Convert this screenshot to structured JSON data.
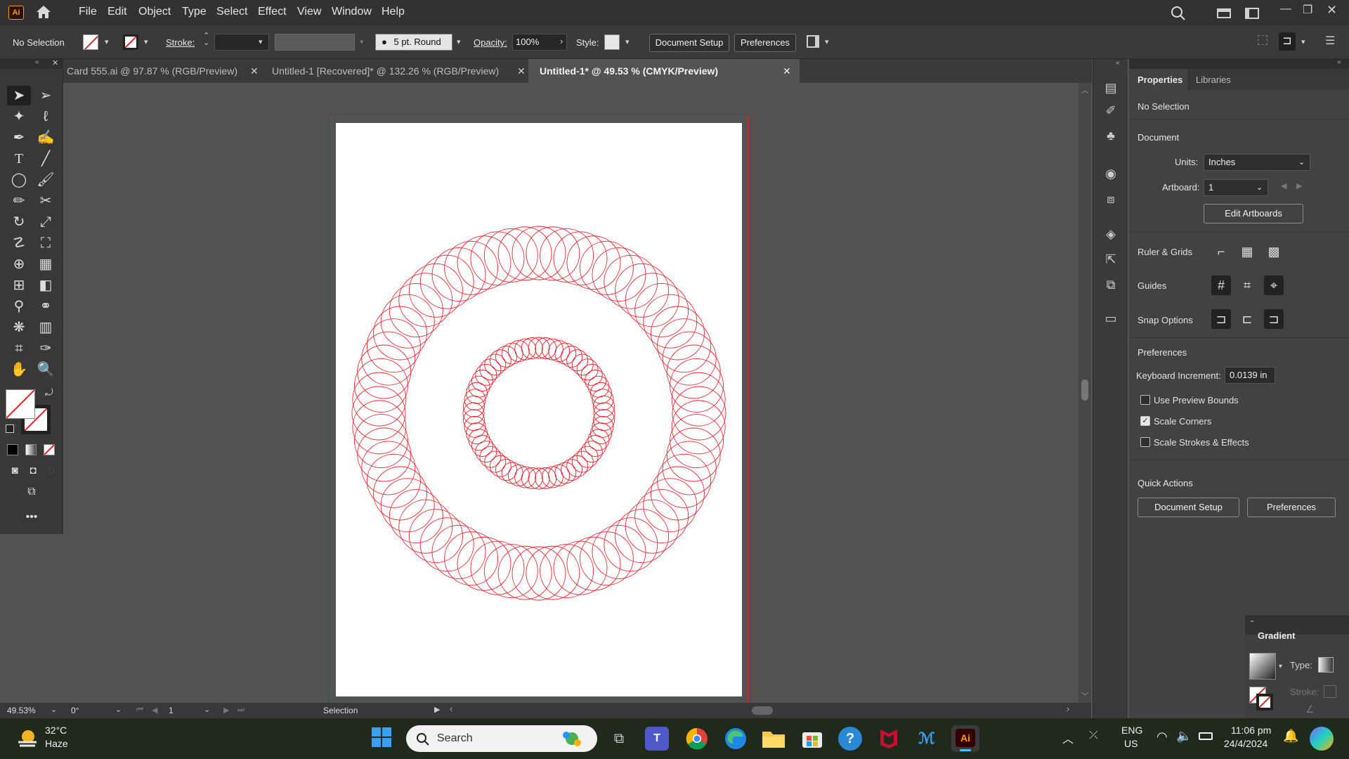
{
  "app": {
    "logo": "Ai",
    "home_icon": "home-icon"
  },
  "menu": [
    "File",
    "Edit",
    "Object",
    "Type",
    "Select",
    "Effect",
    "View",
    "Window",
    "Help"
  ],
  "control": {
    "selection": "No Selection",
    "stroke_label": "Stroke:",
    "brush": "5 pt. Round",
    "opacity_label": "Opacity:",
    "opacity_value": "100%",
    "style_label": "Style:",
    "doc_setup": "Document Setup",
    "preferences": "Preferences"
  },
  "tabs": [
    {
      "label": "Card 555.ai @ 97.87 % (RGB/Preview)",
      "active": false
    },
    {
      "label": "Untitled-1 [Recovered]* @ 132.26 % (RGB/Preview)",
      "active": false
    },
    {
      "label": "Untitled-1* @ 49.53 % (CMYK/Preview)",
      "active": true
    }
  ],
  "status": {
    "zoom": "49.53%",
    "rotation": "0°",
    "artboard": "1",
    "tool": "Selection"
  },
  "properties": {
    "tabs": [
      "Properties",
      "Libraries"
    ],
    "selection": "No Selection",
    "document": "Document",
    "units_label": "Units:",
    "units_value": "Inches",
    "artboard_label": "Artboard:",
    "artboard_value": "1",
    "edit_artboards": "Edit Artboards",
    "ruler_grids": "Ruler & Grids",
    "guides": "Guides",
    "snap_options": "Snap Options",
    "preferences": "Preferences",
    "kb_increment_label": "Keyboard Increment:",
    "kb_increment_value": "0.0139 in",
    "use_preview_bounds": "Use Preview Bounds",
    "scale_corners": "Scale Corners",
    "scale_strokes": "Scale Strokes & Effects",
    "quick_actions": "Quick Actions",
    "qa_doc_setup": "Document Setup",
    "qa_preferences": "Preferences",
    "scale_corners_checked": true
  },
  "gradient_panel": {
    "title": "Gradient",
    "type_label": "Type:",
    "stroke_label": "Stroke:"
  },
  "artwork": {
    "stroke_color": "#e8202a",
    "outer_ring_loops": 72,
    "inner_ring_loops": 60
  },
  "taskbar": {
    "weather_temp": "32°C",
    "weather_desc": "Haze",
    "search_placeholder": "Search",
    "lang_1": "ENG",
    "lang_2": "US",
    "time": "11:06 pm",
    "date": "24/4/2024"
  }
}
